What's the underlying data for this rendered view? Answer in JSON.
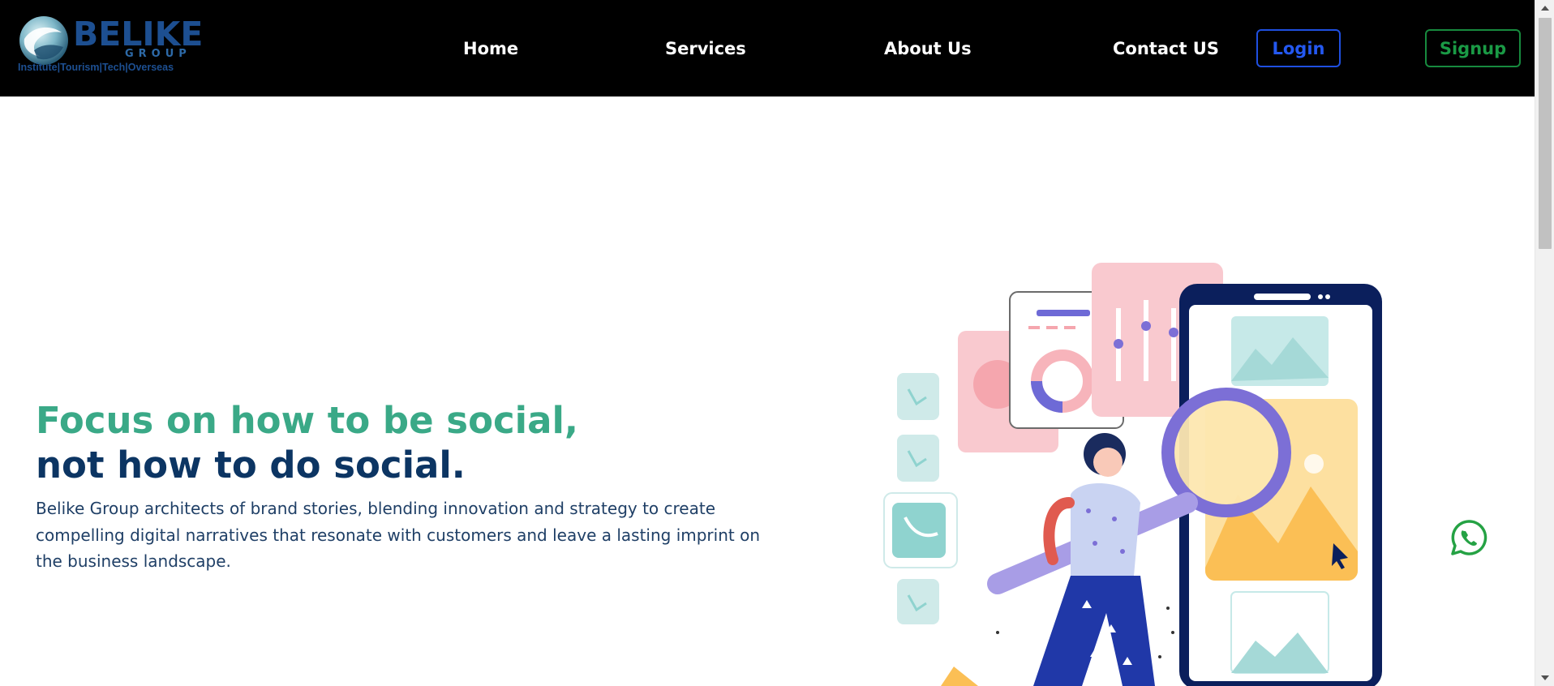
{
  "brand": {
    "name": "BELIKE",
    "sub": "GROUP",
    "tagline": "Institute|Tourism|Tech|Overseas"
  },
  "nav": {
    "home": "Home",
    "services": "Services",
    "about": "About Us",
    "contact": "Contact US",
    "login": "Login",
    "signup": "Signup"
  },
  "hero": {
    "title_line1": "Focus on how to be social,",
    "title_line2": "not how to do social.",
    "description": "Belike Group architects of brand stories, blending innovation and strategy to create compelling digital narratives that resonate with customers and leave a lasting imprint on the business landscape."
  },
  "icons": {
    "logo": "globe-logo-icon",
    "whatsapp": "whatsapp-icon",
    "illustration": "social-media-illustration"
  },
  "colors": {
    "nav_bg": "#000000",
    "title_green": "#3aa987",
    "title_navy": "#0c3563",
    "login_blue": "#2458f0",
    "signup_green": "#1a9a45",
    "whatsapp_green": "#25a244"
  }
}
